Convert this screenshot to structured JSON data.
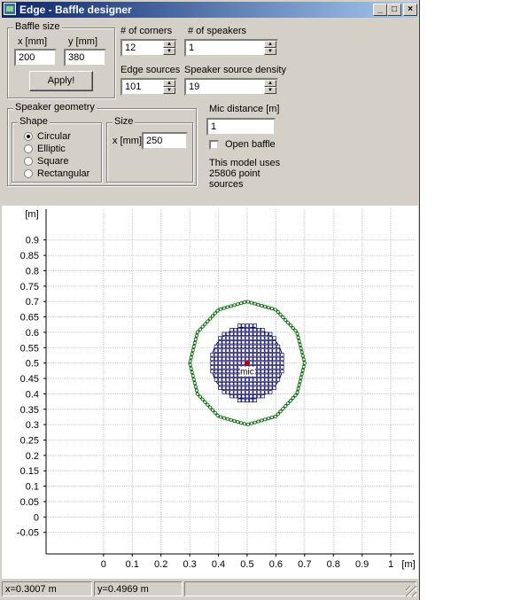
{
  "window": {
    "title": "Edge - Baffle designer",
    "minimize_glyph": "_",
    "maximize_glyph": "□",
    "close_glyph": "×"
  },
  "baffle_size": {
    "label": "Baffle size",
    "x_label": "x [mm]",
    "y_label": "y [mm]",
    "x_value": "200",
    "y_value": "380",
    "apply_label": "Apply!"
  },
  "corners": {
    "label": "# of corners",
    "value": "12"
  },
  "speakers": {
    "label": "# of speakers",
    "value": "1"
  },
  "edge_sources": {
    "label": "Edge sources",
    "value": "101"
  },
  "source_density": {
    "label": "Speaker source density",
    "value": "19"
  },
  "speaker_geometry": {
    "label": "Speaker geometry",
    "shape_label": "Shape",
    "shapes": [
      "Circular",
      "Elliptic",
      "Square",
      "Rectangular"
    ],
    "selected_shape": "Circular",
    "size_label": "Size",
    "size_x_label": "x [mm]",
    "size_x_value": "250"
  },
  "mic": {
    "distance_label": "Mic distance [m]",
    "distance_value": "1",
    "open_baffle_label": "Open baffle",
    "open_baffle_checked": false,
    "mic_marker_label": "mic"
  },
  "model_info": [
    "This model uses",
    "25806 point",
    "sources"
  ],
  "status": {
    "x_readout": "x=0.3007 m",
    "y_readout": "y=0.4969 m"
  },
  "chart_data": {
    "type": "scatter",
    "title": "",
    "xlabel": "[m]",
    "ylabel": "[m]",
    "xlim": [
      -0.2,
      1.08
    ],
    "ylim": [
      -0.12,
      1.0
    ],
    "grid": true,
    "x_ticks": [
      "0",
      "0.1",
      "0.2",
      "0.3",
      "0.4",
      "0.5",
      "0.6",
      "0.7",
      "0.8",
      "0.9",
      "1"
    ],
    "y_ticks": [
      "0.9",
      "0.85",
      "0.8",
      "0.75",
      "0.7",
      "0.65",
      "0.6",
      "0.55",
      "0.5",
      "0.45",
      "0.4",
      "0.35",
      "0.3",
      "0.25",
      "0.2",
      "0.15",
      "0.1",
      "0.05",
      "0",
      "-0.05"
    ],
    "baffle_outline": {
      "center": [
        0.5,
        0.5
      ],
      "radius": 0.2,
      "corners": 12,
      "color": "#107010"
    },
    "speaker": {
      "center": [
        0.5,
        0.5
      ],
      "radius": 0.125,
      "grid_spacing": 0.0135,
      "color": "#000060"
    },
    "mic_point": {
      "x": 0.5,
      "y": 0.5,
      "color": "#c00000"
    }
  }
}
